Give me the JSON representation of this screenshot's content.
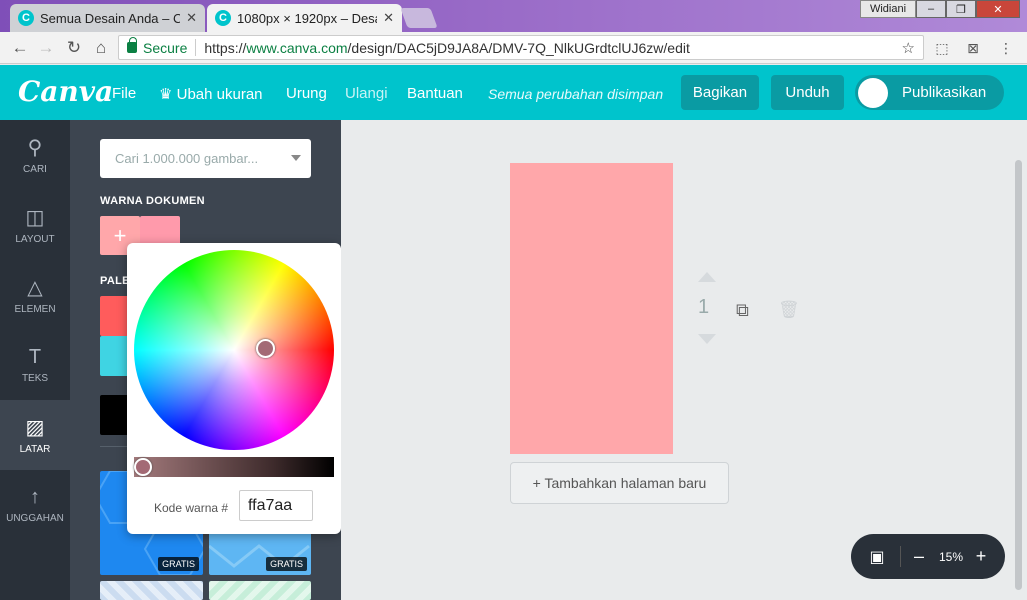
{
  "browser": {
    "tabs": [
      {
        "title": "Semua Desain Anda – Ca",
        "favicon": "C",
        "active": false
      },
      {
        "title": "1080px × 1920px – Desa",
        "favicon": "C",
        "active": true
      }
    ],
    "user": "Widiani",
    "window_buttons": [
      "–",
      "❐",
      "✕"
    ],
    "secure_label": "Secure",
    "url_scheme": "https://",
    "url_host": "www.canva.com",
    "url_path": "/design/DAC5jD9JA8A/DMV-7Q_NlkUGrdtclUJ6zw/edit"
  },
  "header": {
    "logo": "Canva",
    "menu": [
      "File",
      "Ubah ukuran",
      "Urung",
      "Ulangi",
      "Bantuan"
    ],
    "autosave": "Semua perubahan disimpan",
    "share_label": "Bagikan",
    "download_label": "Unduh",
    "publish_label": "Publikasikan"
  },
  "rail": [
    {
      "label": "CARI",
      "icon": "search-icon",
      "glyph": "⚲"
    },
    {
      "label": "LAYOUT",
      "icon": "layout-icon",
      "glyph": "◫"
    },
    {
      "label": "ELEMEN",
      "icon": "shapes-icon",
      "glyph": "△"
    },
    {
      "label": "TEKS",
      "icon": "text-icon",
      "glyph": "T"
    },
    {
      "label": "LATAR",
      "icon": "background-icon",
      "glyph": "▨"
    },
    {
      "label": "UNGGAHAN",
      "icon": "upload-icon",
      "glyph": "↑"
    }
  ],
  "panel": {
    "search_placeholder": "Cari 1.000.000 gambar...",
    "doc_colors_label": "WARNA DOKUMEN",
    "palette_label": "PALET",
    "doc_colors": [
      "#ffa7aa",
      "#ff9aab"
    ],
    "palette_colors": [
      "#ff5c5c",
      "#3fd4e3"
    ],
    "gratis_label": "GRATIS"
  },
  "picker": {
    "hex_label": "Kode warna #",
    "hex_value": "ffa7aa"
  },
  "canvas": {
    "page_number": "1",
    "page_color": "#ffa7aa",
    "add_page_label": "+ Tambahkan halaman baru",
    "zoom": "15%"
  }
}
